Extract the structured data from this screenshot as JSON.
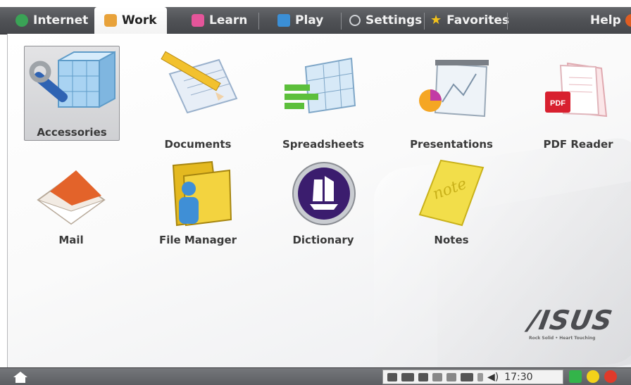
{
  "tabs": [
    {
      "label": "Internet",
      "icon": "globe-icon",
      "color": "#3aa356"
    },
    {
      "label": "Work",
      "icon": "work-icon",
      "color": "#e8a23a"
    },
    {
      "label": "Learn",
      "icon": "learn-icon",
      "color": "#e4559a"
    },
    {
      "label": "Play",
      "icon": "play-icon",
      "color": "#3b8fd6"
    },
    {
      "label": "Settings",
      "icon": "settings-icon",
      "color": "#cfd2d6"
    },
    {
      "label": "Favorites",
      "icon": "star-icon",
      "color": "#f3c21a"
    },
    {
      "label": "Help",
      "icon": "help-icon",
      "color": "#e05d22"
    }
  ],
  "active_tab": "Work",
  "apps": [
    {
      "label": "Accessories",
      "icon": "accessories-icon"
    },
    {
      "label": "Documents",
      "icon": "documents-icon"
    },
    {
      "label": "Spreadsheets",
      "icon": "spreadsheets-icon"
    },
    {
      "label": "Presentations",
      "icon": "presentations-icon"
    },
    {
      "label": "PDF Reader",
      "icon": "pdf-reader-icon"
    },
    {
      "label": "Mail",
      "icon": "mail-icon"
    },
    {
      "label": "File Manager",
      "icon": "file-manager-icon"
    },
    {
      "label": "Dictionary",
      "icon": "dictionary-icon"
    },
    {
      "label": "Notes",
      "icon": "notes-icon"
    }
  ],
  "selected_app": "Accessories",
  "brand": {
    "logo": "/ISUS",
    "tagline": "Rock Solid • Heart Touching"
  },
  "taskbar": {
    "clock": "17:30",
    "pdf_badge": "PDF",
    "note_text": "note",
    "colors": {
      "green": "#33b44a",
      "yellow": "#f3d21a",
      "red": "#e03a2a"
    }
  }
}
